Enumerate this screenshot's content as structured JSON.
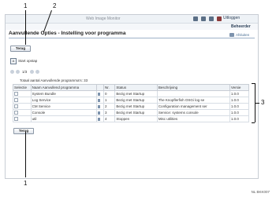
{
  "header": {
    "app_title": "Web Image Monitor",
    "login_label": "Uitloggen",
    "user_label": "Beheerder"
  },
  "page": {
    "title": "Aanvullende Opties - Instelling voor programma",
    "right_link": "Afsluiten"
  },
  "buttons": {
    "back_top": "Terug",
    "back_bottom": "Terug",
    "start_label": "Start opstap"
  },
  "pager": {
    "range": "1/3"
  },
  "table": {
    "total_label": "Totaal aantal Aanvullende programma's: 33",
    "columns": [
      "Selectie",
      "Naam Aanvullend programma",
      "",
      "Nr.",
      "Status",
      "Beschrijving",
      "Versie"
    ],
    "rows": [
      {
        "name": "System Bundle",
        "nr": "0",
        "status": "Bezig met Startup",
        "desc": "",
        "version": "1.0.0"
      },
      {
        "name": "Log Service",
        "nr": "1",
        "status": "Bezig met Startup",
        "desc": "The Knopflerfish OSGi log se",
        "version": "1.0.0"
      },
      {
        "name": "CM Service",
        "nr": "2",
        "status": "Bezig met Startup",
        "desc": "Configuration management ser",
        "version": "1.0.0"
      },
      {
        "name": "Console",
        "nr": "3",
        "status": "Bezig met Startup",
        "desc": "Service: systems console",
        "version": "1.0.0"
      },
      {
        "name": "util",
        "nr": "4",
        "status": "Stoppen",
        "desc": "Misc utilities",
        "version": "1.0.0"
      }
    ]
  },
  "callouts": [
    "1",
    "2",
    "3",
    "1"
  ],
  "footnote": "NL BKK007"
}
